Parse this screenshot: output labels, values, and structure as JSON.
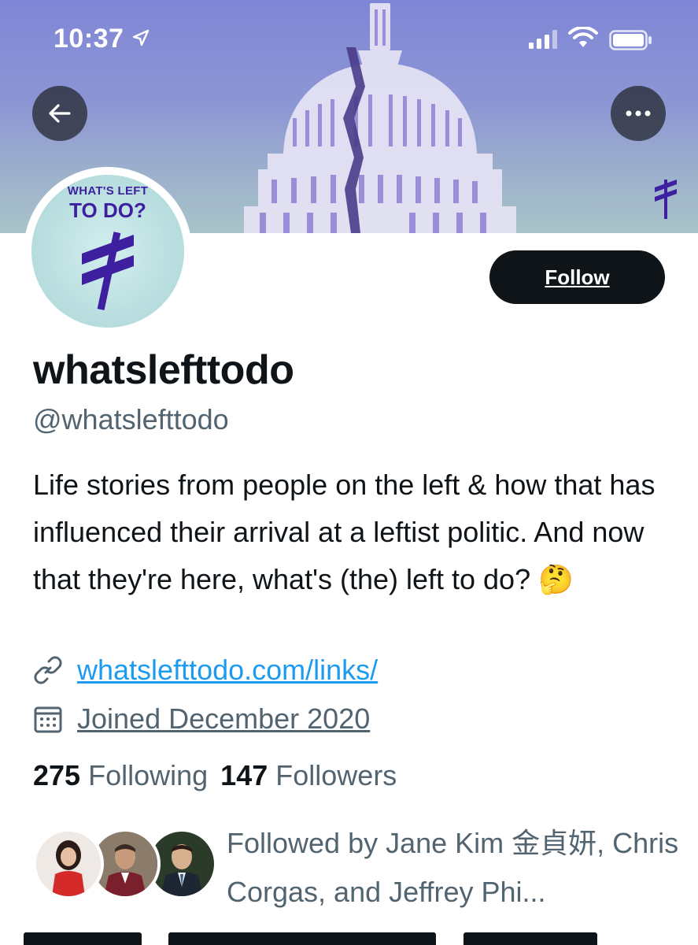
{
  "status_bar": {
    "time": "10:37"
  },
  "header": {
    "back_icon": "arrow-left-icon",
    "more_icon": "more-horizontal-icon"
  },
  "avatar": {
    "line1": "WHAT'S LEFT",
    "line2": "TO DO?"
  },
  "actions": {
    "follow_label": "Follow"
  },
  "profile": {
    "display_name": "whatslefttodo",
    "handle": "@whatslefttodo",
    "bio": "Life stories from people on the left & how that has influenced their arrival at a leftist politic. And now that they're here, what's (the) left to do? 🤔",
    "website": "whatslefttodo.com/links/",
    "joined": "Joined December 2020"
  },
  "stats": {
    "following_count": "275",
    "following_label": "Following",
    "followers_count": "147",
    "followers_label": "Followers"
  },
  "followed_by": {
    "text": "Followed by Jane Kim  金貞妍, Chris Corgas, and Jeffrey Phi..."
  },
  "colors": {
    "accent_link": "#1d9bf0",
    "brand_purple": "#3d1fa0",
    "follow_bg": "#0f1419",
    "secondary_text": "#536471"
  }
}
